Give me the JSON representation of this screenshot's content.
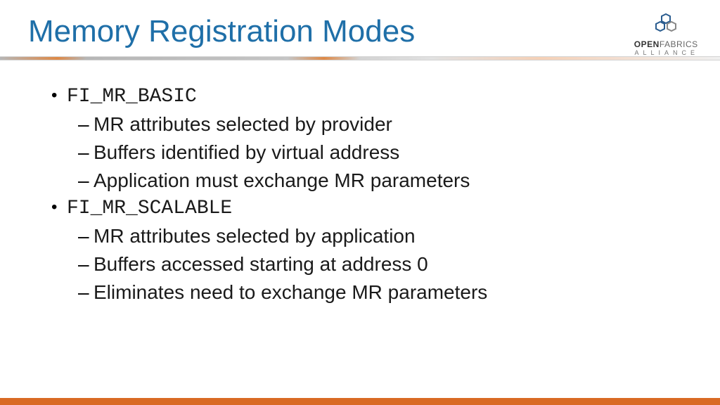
{
  "title": "Memory Registration Modes",
  "logo": {
    "line1_bold": "OPEN",
    "line1_light": "FABRICS",
    "line2": "ALLIANCE"
  },
  "bullets": [
    {
      "label": "FI_MR_BASIC",
      "subs": [
        "MR attributes selected by provider",
        "Buffers identified by virtual address",
        "Application must exchange MR parameters"
      ]
    },
    {
      "label": "FI_MR_SCALABLE",
      "subs": [
        "MR attributes selected by application",
        "Buffers accessed starting at address 0",
        "Eliminates need to exchange MR parameters"
      ]
    }
  ]
}
